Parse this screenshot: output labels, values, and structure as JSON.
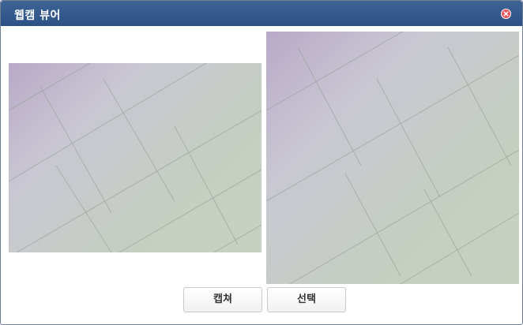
{
  "window": {
    "title": "웹캠 뷰어",
    "close_icon": "close-icon"
  },
  "views": {
    "live": {
      "label": "webcam-live-feed"
    },
    "captured": {
      "label": "captured-image"
    }
  },
  "buttons": {
    "capture_label": "캡쳐",
    "select_label": "선택"
  },
  "colors": {
    "titlebar": "#2f5487",
    "close": "#e8545b"
  }
}
